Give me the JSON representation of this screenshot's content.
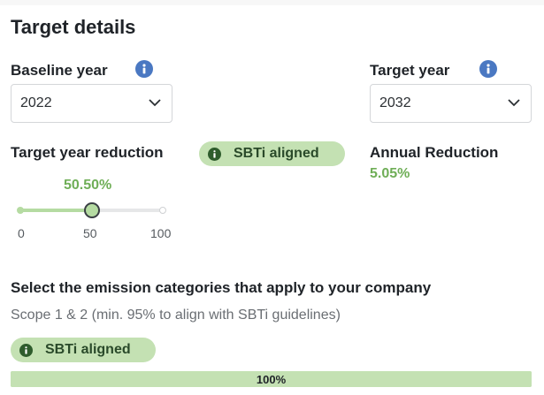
{
  "section_title": "Target details",
  "baseline": {
    "label": "Baseline year",
    "value": "2022"
  },
  "target": {
    "label": "Target year",
    "value": "2032"
  },
  "reduction": {
    "label": "Target year reduction",
    "badge": "SBTi aligned",
    "value_text": "50.50%",
    "slider": {
      "min": 0,
      "max": 100,
      "value": 50.5,
      "tick_labels": [
        "0",
        "50",
        "100"
      ]
    }
  },
  "annual": {
    "label": "Annual Reduction",
    "value": "5.05%"
  },
  "categories": {
    "heading": "Select the emission categories that apply to your company",
    "scope_text": "Scope 1 & 2 (min. 95% to align with SBTi guidelines)",
    "badge": "SBTi aligned",
    "progress": {
      "percent": 100,
      "text": "100%"
    }
  },
  "colors": {
    "accent_green": "#6fae57",
    "pill_green": "#c4e1b3",
    "info_blue": "#4a78c2"
  },
  "icons": {
    "info": "info-icon",
    "chevron": "chevron-down-icon",
    "badge_info": "info-dot-icon"
  }
}
